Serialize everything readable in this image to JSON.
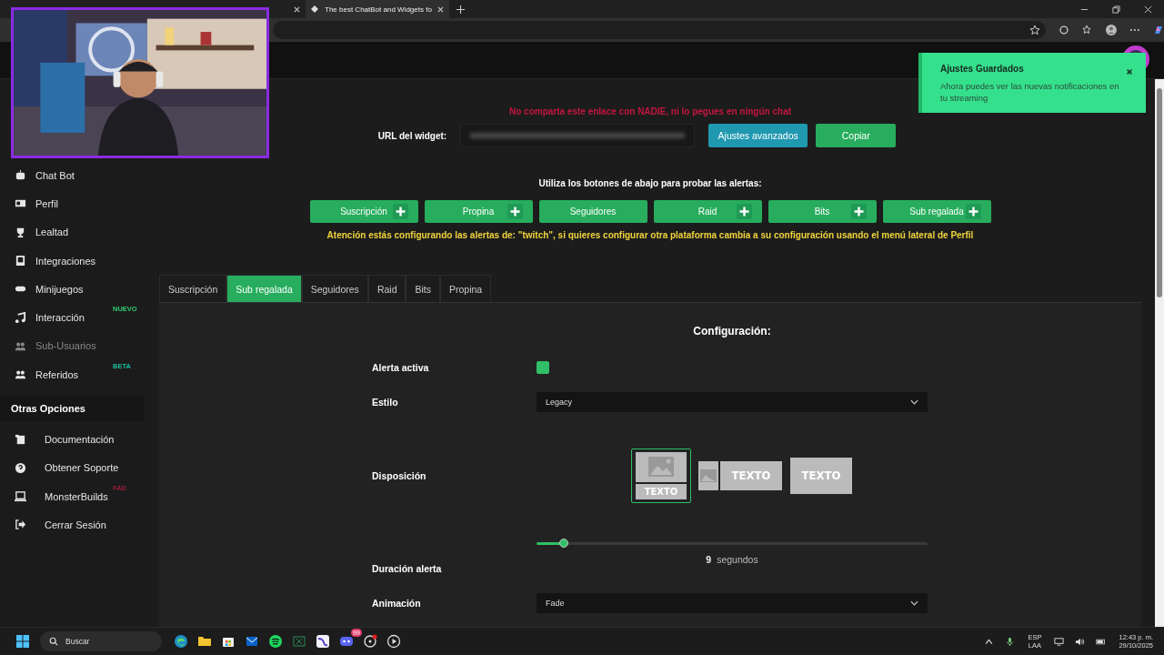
{
  "browser": {
    "tabs": [
      {
        "title": "The best ChatBot and Widgets fo",
        "selected": true
      }
    ]
  },
  "toast": {
    "title": "Ajustes Guardados",
    "message": "Ahora puedes ver las nuevas notificaciones en tu streaming"
  },
  "sidebar": {
    "items": [
      {
        "label": "Chat Bot",
        "disabled": false
      },
      {
        "label": "Perfil",
        "disabled": false
      },
      {
        "label": "Lealtad",
        "disabled": false
      },
      {
        "label": "Integraciones",
        "disabled": false
      },
      {
        "label": "Minijuegos",
        "disabled": false
      },
      {
        "label": "Interacción",
        "disabled": false,
        "badge": "NUEVO",
        "color": "#2ecc71"
      },
      {
        "label": "Sub-Usuarios",
        "disabled": true
      },
      {
        "label": "Referidos",
        "disabled": false,
        "badge": "BETA",
        "color": "#1abc9c"
      }
    ],
    "section": "Otras Opciones",
    "other_items": [
      {
        "label": "Documentación",
        "disabled": false
      },
      {
        "label": "Obtener Soporte",
        "disabled": false
      },
      {
        "label": "MonsterBuilds",
        "disabled": false,
        "badge": "FAD",
        "color": "#9b1c3a"
      },
      {
        "label": "Cerrar Sesión",
        "disabled": false
      }
    ]
  },
  "warning": "No comparta este enlace con NADIE, ni lo pegues en ningún chat",
  "url_label": "URL del widget:",
  "url_buttons": [
    {
      "label": "Ajustes avanzados",
      "kind": "info"
    },
    {
      "label": "Copiar",
      "kind": "success"
    }
  ],
  "test_prompt": "Utiliza los botones de abajo para probar las alertas:",
  "test_buttons": [
    {
      "label": "Suscripción",
      "plus": true
    },
    {
      "label": "Propina",
      "plus": true
    },
    {
      "label": "Seguidores",
      "plus": false
    },
    {
      "label": "Raid",
      "plus": true
    },
    {
      "label": "Bits",
      "plus": true
    },
    {
      "label": "Sub regalada",
      "plus": true
    }
  ],
  "notice": "Atención estás configurando las alertas de: **\"twitch\"**, si quieres configurar otra plataforma cambia a su configuración usando el menú lateral de Perfil",
  "tabs": [
    {
      "label": "Suscripción",
      "selected": false
    },
    {
      "label": "Sub regalada",
      "selected": true
    },
    {
      "label": "Seguidores",
      "selected": false
    },
    {
      "label": "Raid",
      "selected": false
    },
    {
      "label": "Bits",
      "selected": false
    },
    {
      "label": "Propina",
      "selected": false
    }
  ],
  "config_title": "Configuración:",
  "fields": [
    {
      "kind": "checkbox",
      "label": "Alerta activa",
      "checked": true
    },
    {
      "kind": "select",
      "label": "Estilo",
      "value": "Legacy"
    },
    {
      "kind": "layout",
      "label": "Disposición",
      "options": [
        {
          "kind": "stacked",
          "text": "TEXTO",
          "selected": true
        },
        {
          "kind": "side",
          "text": "TEXTO",
          "selected": false
        },
        {
          "kind": "overlay",
          "text": "TEXTO",
          "selected": false
        }
      ]
    },
    {
      "kind": "slider",
      "label": "Duración alerta",
      "level": 0.07,
      "value": "9",
      "unit": "segundos"
    },
    {
      "kind": "select",
      "label": "Animación",
      "value": "Fade"
    }
  ],
  "taskbar": {
    "search": "Buscar",
    "language": "ESP",
    "layout": "LAA",
    "time": "12:43 p. m.",
    "date": "29/10/2025",
    "discord_badge": "99"
  }
}
